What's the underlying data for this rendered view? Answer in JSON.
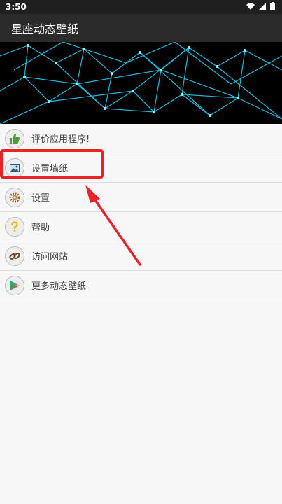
{
  "status_bar": {
    "time": "3:50"
  },
  "app_bar": {
    "title": "星座动态壁纸"
  },
  "menu": [
    {
      "label": "评价应用程序!",
      "icon": "thumbs-up-icon"
    },
    {
      "label": "设置墙纸",
      "icon": "image-icon"
    },
    {
      "label": "设置",
      "icon": "gear-icon"
    },
    {
      "label": "帮助",
      "icon": "question-icon"
    },
    {
      "label": "访问网站",
      "icon": "link-icon"
    },
    {
      "label": "更多动态壁纸",
      "icon": "play-store-icon"
    }
  ],
  "colors": {
    "status_bar": "#1f1f1f",
    "app_bar": "#2b2b2b",
    "banner_lines": "#2bd8ff",
    "highlight": "#e8232a"
  }
}
